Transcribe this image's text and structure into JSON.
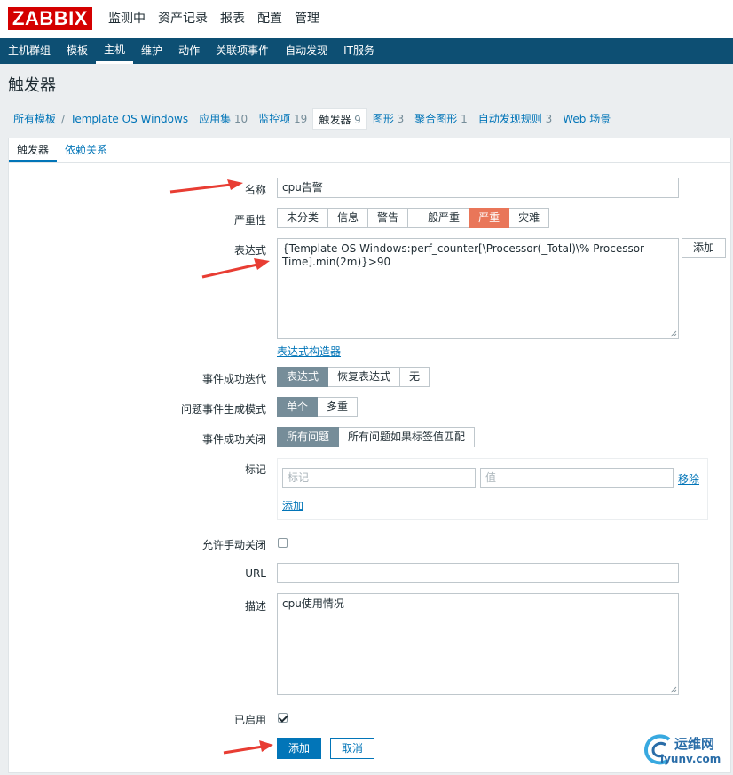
{
  "app": {
    "logo_text": "ZABBIX"
  },
  "main_menu": [
    {
      "label": "监测中",
      "active": false
    },
    {
      "label": "资产记录",
      "active": false
    },
    {
      "label": "报表",
      "active": false
    },
    {
      "label": "配置",
      "active": true
    },
    {
      "label": "管理",
      "active": false
    }
  ],
  "sub_menu": [
    {
      "label": "主机群组",
      "active": false
    },
    {
      "label": "模板",
      "active": false
    },
    {
      "label": "主机",
      "active": true
    },
    {
      "label": "维护",
      "active": false
    },
    {
      "label": "动作",
      "active": false
    },
    {
      "label": "关联项事件",
      "active": false
    },
    {
      "label": "自动发现",
      "active": false
    },
    {
      "label": "IT服务",
      "active": false
    }
  ],
  "page_title": "触发器",
  "breadcrumb": {
    "all_templates": "所有模板",
    "separator": "/",
    "template": "Template OS Windows",
    "items": [
      {
        "label": "应用集",
        "count": "10"
      },
      {
        "label": "监控项",
        "count": "19"
      },
      {
        "label": "触发器",
        "count": "9",
        "current": true
      },
      {
        "label": "图形",
        "count": "3"
      },
      {
        "label": "聚合图形",
        "count": "1"
      },
      {
        "label": "自动发现规则",
        "count": "3"
      },
      {
        "label": "Web 场景",
        "count": ""
      }
    ]
  },
  "tabs": [
    {
      "label": "触发器",
      "active": true
    },
    {
      "label": "依赖关系",
      "active": false
    }
  ],
  "form": {
    "name_label": "名称",
    "name_value": "cpu告警",
    "severity_label": "严重性",
    "severity_options": [
      "未分类",
      "信息",
      "警告",
      "一般严重",
      "严重",
      "灾难"
    ],
    "severity_selected": "严重",
    "expression_label": "表达式",
    "expression_value": "{Template OS Windows:perf_counter[\\Processor(_Total)\\% Processor Time].min(2m)}>90",
    "expression_add": "添加",
    "expression_builder": "表达式构造器",
    "ok_event_label": "事件成功迭代",
    "ok_event_options": [
      "表达式",
      "恢复表达式",
      "无"
    ],
    "ok_event_selected": "表达式",
    "problem_mode_label": "问题事件生成模式",
    "problem_mode_options": [
      "单个",
      "多重"
    ],
    "problem_mode_selected": "单个",
    "ok_close_label": "事件成功关闭",
    "ok_close_options": [
      "所有问题",
      "所有问题如果标签值匹配"
    ],
    "ok_close_selected": "所有问题",
    "tags_label": "标记",
    "tag_placeholder": "标记",
    "value_placeholder": "值",
    "remove_link": "移除",
    "add_link": "添加",
    "manual_close_label": "允许手动关闭",
    "manual_close_checked": false,
    "url_label": "URL",
    "url_value": "",
    "description_label": "描述",
    "description_value": "cpu使用情况",
    "enabled_label": "已启用",
    "enabled_checked": true,
    "submit_button": "添加",
    "cancel_button": "取消"
  },
  "watermark": {
    "line1": "运维网",
    "line2": "iyunv.com"
  },
  "colors": {
    "nav_bg": "#0d4f73",
    "logo_bg": "#d40000",
    "accent": "#0275b8",
    "severity_high": "#e97659",
    "selected_grey": "#768d99",
    "arrow_red": "#e83d33"
  }
}
